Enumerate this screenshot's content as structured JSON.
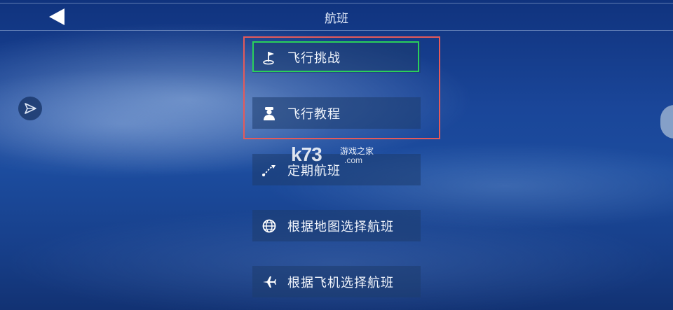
{
  "header": {
    "title": "航班"
  },
  "menu": {
    "items": [
      {
        "label": "飞行挑战",
        "icon": "flag-golf-icon"
      },
      {
        "label": "飞行教程",
        "icon": "pilot-icon"
      },
      {
        "label": "定期航班",
        "icon": "flight-route-icon"
      },
      {
        "label": "根据地图选择航班",
        "icon": "globe-icon"
      },
      {
        "label": "根据飞机选择航班",
        "icon": "airplane-icon"
      }
    ]
  },
  "watermark": {
    "big": "k73",
    "cn": "游戏之家",
    "com": ".com"
  },
  "colors": {
    "highlight_green": "#2ad05a",
    "annotation_red": "#e45a5a"
  }
}
